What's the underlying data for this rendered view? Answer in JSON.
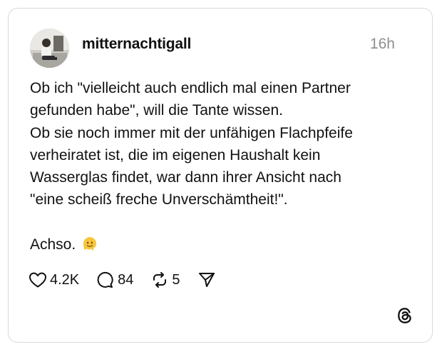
{
  "post": {
    "username": "mitternachtigall",
    "timestamp": "16h",
    "lines": [
      "Ob ich \"vielleicht auch endlich mal einen Partner",
      "gefunden habe\", will die Tante wissen.",
      "Ob sie noch immer mit der unfähigen Flachpfeife",
      "verheiratet ist, die im eigenen Haushalt kein",
      "Wasserglas findet, war dann ihrer Ansicht nach",
      "\"eine scheiß freche Unverschämtheit!\"."
    ],
    "closing": "Achso.",
    "closing_emoji": "melting-face-emoji"
  },
  "actions": {
    "likes": "4.2K",
    "replies": "84",
    "reposts": "5"
  },
  "icons": {
    "like": "heart-icon",
    "reply": "comment-bubble-icon",
    "repost": "repost-icon",
    "share": "send-icon",
    "brand": "threads-logo-icon"
  },
  "colors": {
    "text": "#111111",
    "muted": "#8e8e8e",
    "border": "#d9d9d9",
    "emoji": "#f7c63b"
  }
}
